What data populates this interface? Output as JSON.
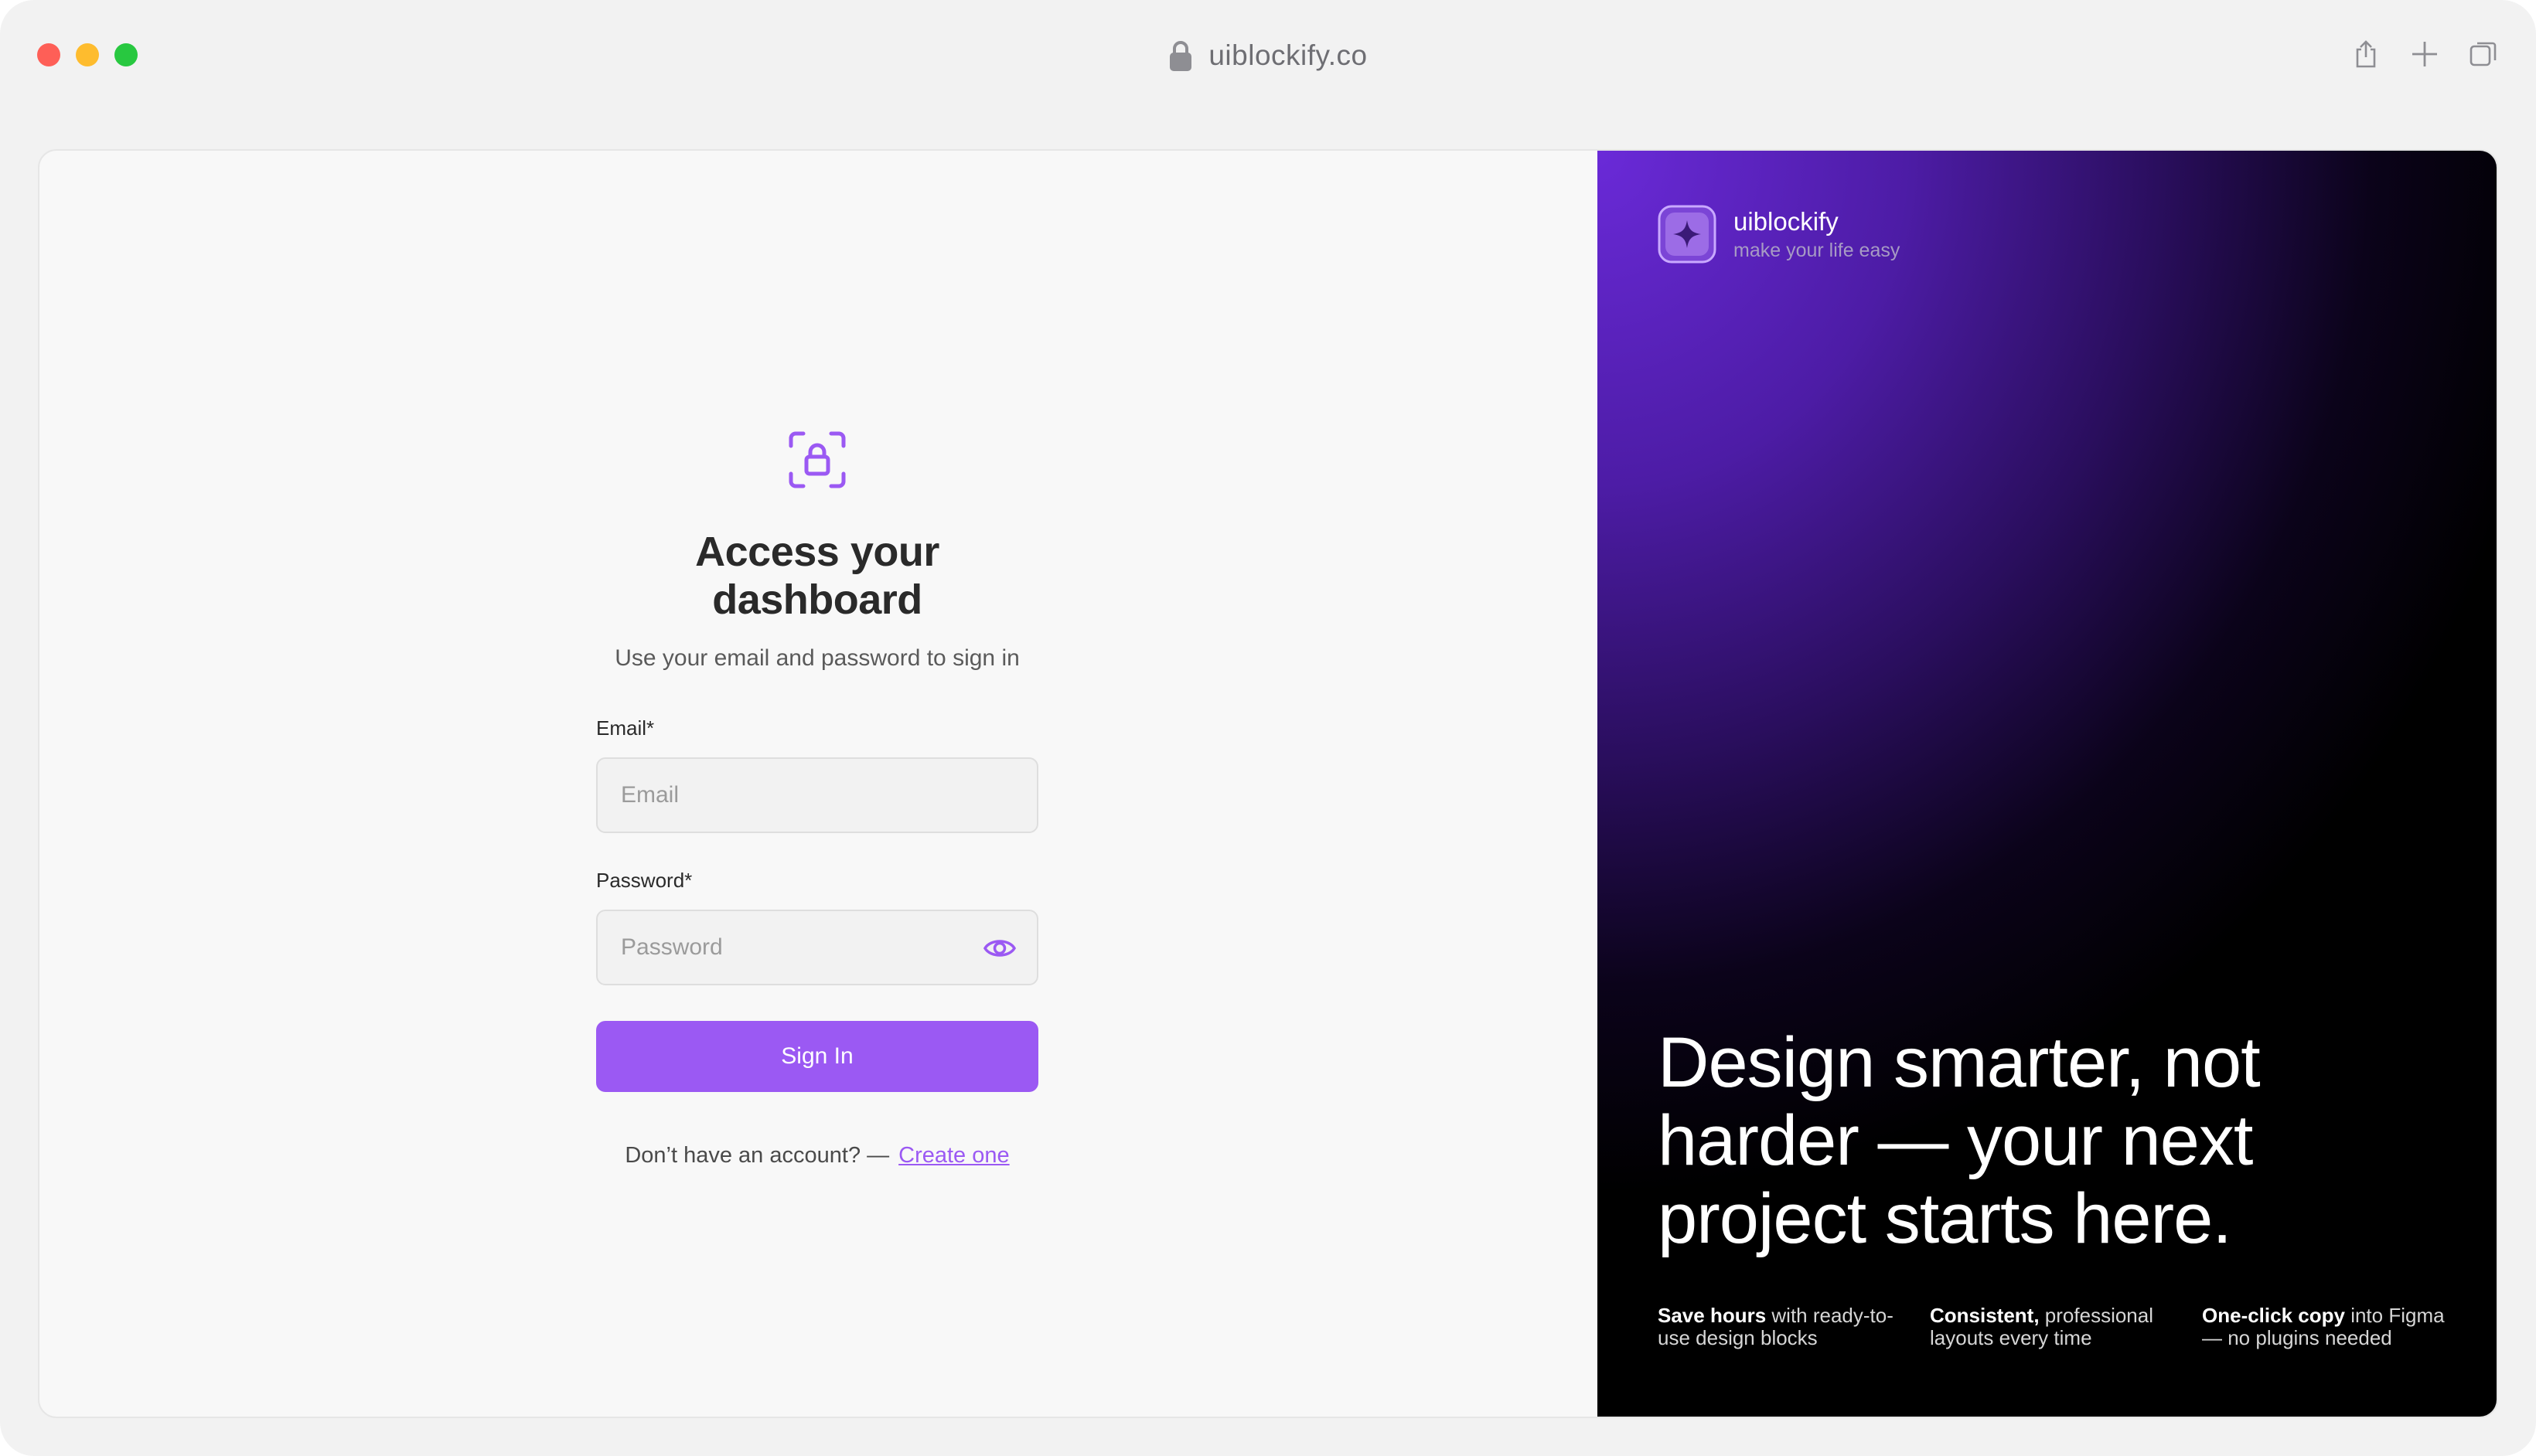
{
  "browser": {
    "url": "uiblockify.co"
  },
  "form": {
    "title": "Access your dashboard",
    "subtitle": "Use your email and password to sign in",
    "email_label": "Email*",
    "email_placeholder": "Email",
    "email_value": "",
    "password_label": "Password*",
    "password_placeholder": "Password",
    "password_value": "",
    "signin_label": "Sign In",
    "signup_prompt": "Don’t have an account? —",
    "signup_link": "Create one"
  },
  "hero": {
    "brand_name": "uiblockify",
    "brand_tagline": "make your life easy",
    "headline": "Design smarter, not harder — your next project starts here.",
    "features": [
      {
        "strong": "Save hours",
        "rest": " with ready-to-use design blocks"
      },
      {
        "strong": "Consistent,",
        "rest": " professional layouts every time"
      },
      {
        "strong": "One-click copy",
        "rest": " into Figma — no plugins needed"
      }
    ]
  },
  "colors": {
    "accent": "#9b59f3",
    "hero_gradient_start": "#6a2ad8",
    "hero_gradient_end": "#000000"
  },
  "icons": {
    "lock": "lock-icon",
    "face_lock": "face-lock-icon",
    "eye": "eye-icon",
    "brand": "sparkle-icon",
    "share": "share-icon",
    "plus": "plus-icon",
    "tabs": "tabs-overview-icon"
  }
}
